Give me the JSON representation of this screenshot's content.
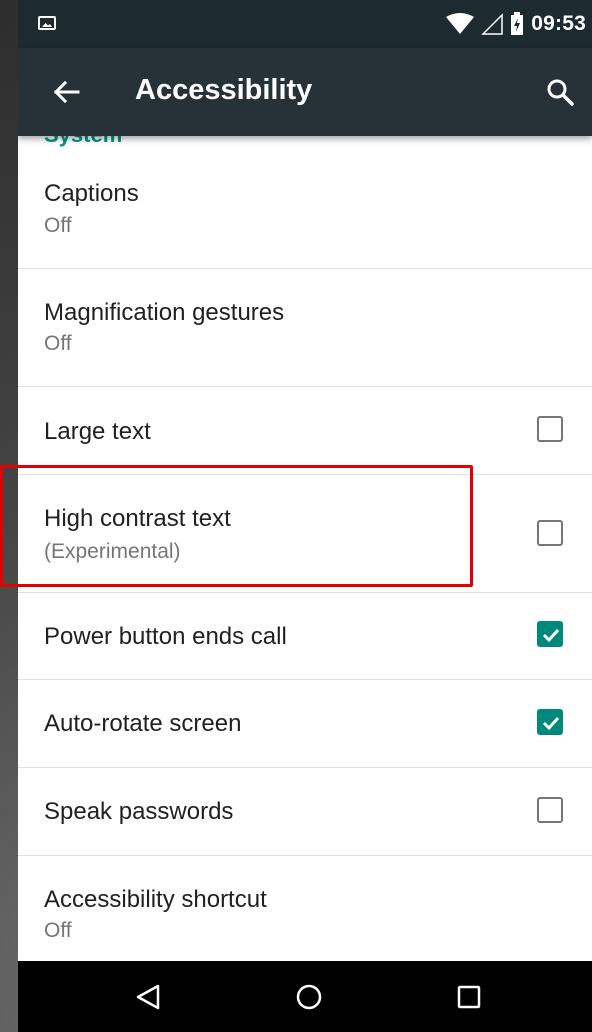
{
  "status_bar": {
    "time": "09:53",
    "icons": [
      "image-notification-icon",
      "wifi-icon",
      "signal-icon",
      "battery-charging-icon"
    ]
  },
  "app_bar": {
    "title": "Accessibility",
    "back_icon": "arrow-back-icon",
    "search_icon": "search-icon"
  },
  "section": {
    "header": "System"
  },
  "settings": [
    {
      "title": "Captions",
      "subtitle": "Off"
    },
    {
      "title": "Magnification gestures",
      "subtitle": "Off"
    },
    {
      "title": "Large text",
      "checked": false
    },
    {
      "title": "High contrast text",
      "subtitle": "(Experimental)",
      "checked": false
    },
    {
      "title": "Power button ends call",
      "checked": true
    },
    {
      "title": "Auto-rotate screen",
      "checked": true
    },
    {
      "title": "Speak passwords",
      "checked": false
    },
    {
      "title": "Accessibility shortcut",
      "subtitle": "Off"
    }
  ],
  "nav_bar": {
    "icons": [
      "back-triangle-icon",
      "home-circle-icon",
      "recents-square-icon"
    ]
  },
  "colors": {
    "status_bar": "#1d2a2f",
    "app_bar": "#263238",
    "accent": "#009688",
    "checkbox_checked": "#00897b",
    "highlight": "#e30000"
  }
}
